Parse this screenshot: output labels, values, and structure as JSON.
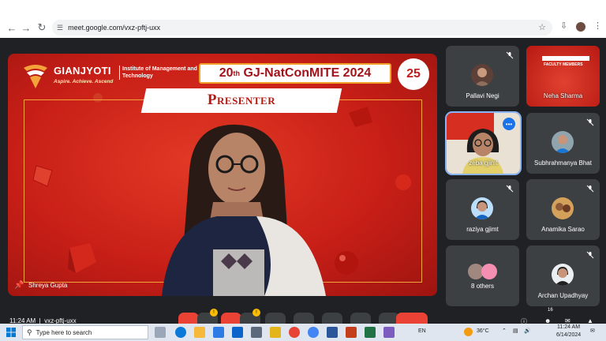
{
  "browser": {
    "url": "meet.google.com/vxz-pftj-uxx",
    "back_icon": "arrow-left-icon",
    "forward_icon": "arrow-right-icon",
    "reload_icon": "reload-icon"
  },
  "slide": {
    "logo_name": "GIANJYOTI",
    "logo_tagline": "Aspire. Achieve. Ascend",
    "institute": "Institute of Management and Technology",
    "conf_prefix": "20",
    "conf_sup": "th",
    "conf_rest": " GJ-NatConMITE 2024",
    "anniversary": "25",
    "presenter_label": "Presenter"
  },
  "main": {
    "presenter_name": "Shreya Gupta"
  },
  "participants": [
    {
      "name": "Pallavi Negi",
      "muted": true
    },
    {
      "name": "Neha Sharma",
      "muted": false,
      "banner": "FACULTY MEMBERS"
    },
    {
      "name": "zeba gjimt",
      "muted": false,
      "speaking": true
    },
    {
      "name": "Subhrahmanya Bhat",
      "muted": true
    },
    {
      "name": "raziya gjimt",
      "muted": true
    },
    {
      "name": "Anamika Sarao",
      "muted": true
    },
    {
      "name": "8 others",
      "muted": false
    },
    {
      "name": "Archan Upadhyay",
      "muted": true
    }
  ],
  "meet_bar": {
    "time": "11:24 AM",
    "code": "vxz-pftj-uxx",
    "participant_count": "16",
    "badge_1": "!",
    "badge_2": "!"
  },
  "taskbar": {
    "search_placeholder": "Type here to search",
    "language": "EN",
    "temperature": "36°C",
    "clock_time": "11:24 AM",
    "clock_date": "6/14/2024"
  },
  "colors": {
    "slide_red": "#c81f17",
    "accent_orange": "#f3a33a",
    "meet_dark": "#202124",
    "tile_gray": "#3c4043",
    "hangup_red": "#ea4335"
  }
}
